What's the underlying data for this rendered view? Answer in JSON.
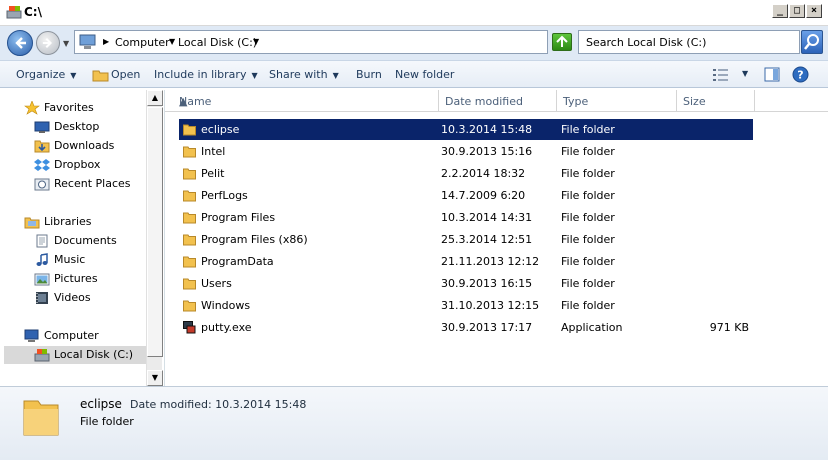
{
  "window": {
    "title": "C:\\"
  },
  "address": {
    "crumbs": [
      "Computer",
      "Local Disk (C:)"
    ],
    "search_placeholder": "Search Local Disk (C:)"
  },
  "toolbar": {
    "organize": "Organize",
    "open": "Open",
    "include": "Include in library",
    "share": "Share with",
    "burn": "Burn",
    "new_folder": "New folder"
  },
  "sidebar": {
    "favorites": "Favorites",
    "desktop": "Desktop",
    "downloads": "Downloads",
    "dropbox": "Dropbox",
    "recent": "Recent Places",
    "libraries": "Libraries",
    "documents": "Documents",
    "music": "Music",
    "pictures": "Pictures",
    "videos": "Videos",
    "computer": "Computer",
    "localdisk": "Local Disk (C:)"
  },
  "columns": {
    "name": "Name",
    "date": "Date modified",
    "type": "Type",
    "size": "Size"
  },
  "files": [
    {
      "name": "eclipse",
      "date": "10.3.2014 15:48",
      "type": "File folder",
      "size": "",
      "icon": "folder-icon"
    },
    {
      "name": "Intel",
      "date": "30.9.2013 15:16",
      "type": "File folder",
      "size": "",
      "icon": "folder-icon"
    },
    {
      "name": "Pelit",
      "date": "2.2.2014 18:32",
      "type": "File folder",
      "size": "",
      "icon": "folder-icon"
    },
    {
      "name": "PerfLogs",
      "date": "14.7.2009 6:20",
      "type": "File folder",
      "size": "",
      "icon": "folder-icon"
    },
    {
      "name": "Program Files",
      "date": "10.3.2014 14:31",
      "type": "File folder",
      "size": "",
      "icon": "folder-icon"
    },
    {
      "name": "Program Files (x86)",
      "date": "25.3.2014 12:51",
      "type": "File folder",
      "size": "",
      "icon": "folder-icon"
    },
    {
      "name": "ProgramData",
      "date": "21.11.2013 12:12",
      "type": "File folder",
      "size": "",
      "icon": "folder-icon"
    },
    {
      "name": "Users",
      "date": "30.9.2013 16:15",
      "type": "File folder",
      "size": "",
      "icon": "folder-icon"
    },
    {
      "name": "Windows",
      "date": "31.10.2013 12:15",
      "type": "File folder",
      "size": "",
      "icon": "folder-icon"
    },
    {
      "name": "putty.exe",
      "date": "30.9.2013 17:17",
      "type": "Application",
      "size": "971 KB",
      "icon": "putty-icon"
    }
  ],
  "details": {
    "name": "eclipse",
    "meta": "Date modified: 10.3.2014 15:48",
    "type": "File folder"
  },
  "colors": {
    "selection": "#0a246a",
    "toolbar_text": "#1e395b",
    "folder": "#f2c14e"
  }
}
